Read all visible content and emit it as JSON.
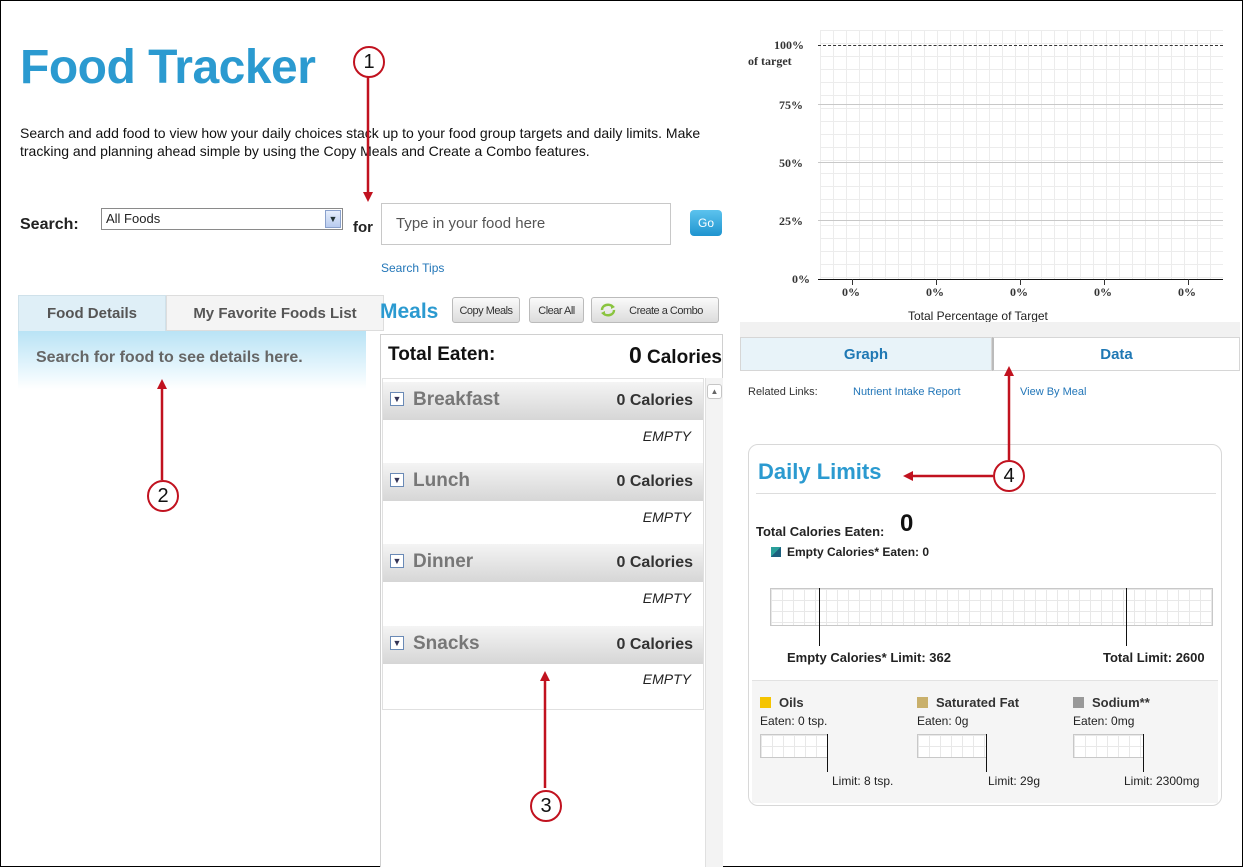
{
  "header": {
    "title": "Food Tracker",
    "intro": "Search and add food to view how your daily choices stack up to your food group targets and daily limits. Make tracking and planning ahead simple by using the Copy Meals and Create a Combo features."
  },
  "search": {
    "label": "Search:",
    "category_selected": "All Foods",
    "for_label": "for",
    "placeholder": "Type in your food here",
    "go_label": "Go",
    "tips_label": "Search Tips"
  },
  "left_tabs": {
    "items": [
      {
        "label": "Food Details",
        "active": true
      },
      {
        "label": "My Favorite Foods List",
        "active": false
      }
    ],
    "details_text": "Search for food to see details here."
  },
  "meals": {
    "title": "Meals",
    "buttons": {
      "copy": "Copy Meals",
      "clear": "Clear All",
      "combo": "Create a Combo"
    },
    "total_label": "Total Eaten:",
    "total_value": "0",
    "total_unit": "Calories",
    "items": [
      {
        "name": "Breakfast",
        "calories": "0 Calories",
        "status": "EMPTY"
      },
      {
        "name": "Lunch",
        "calories": "0 Calories",
        "status": "EMPTY"
      },
      {
        "name": "Dinner",
        "calories": "0 Calories",
        "status": "EMPTY"
      },
      {
        "name": "Snacks",
        "calories": "0 Calories",
        "status": "EMPTY"
      }
    ]
  },
  "graph": {
    "y_ticks": [
      "100%",
      "75%",
      "50%",
      "25%",
      "0%"
    ],
    "y_unit": "of target",
    "x_values": [
      "0%",
      "0%",
      "0%",
      "0%",
      "0%"
    ],
    "x_title": "Total Percentage of Target",
    "tabs": {
      "graph": "Graph",
      "data": "Data"
    }
  },
  "related": {
    "label": "Related Links:",
    "links": [
      "Nutrient Intake Report",
      "View By Meal"
    ]
  },
  "daily_limits": {
    "title": "Daily Limits",
    "total_label": "Total Calories Eaten:",
    "total_value": "0",
    "empty_label": "Empty Calories* Eaten: 0",
    "empty_limit": "Empty Calories* Limit: 362",
    "total_limit": "Total Limit: 2600",
    "nutrients": [
      {
        "name": "Oils",
        "color": "#f5c400",
        "eaten": "Eaten: 0 tsp.",
        "limit": "Limit: 8 tsp."
      },
      {
        "name": "Saturated Fat",
        "color": "#c9b06b",
        "eaten": "Eaten: 0g",
        "limit": "Limit: 29g"
      },
      {
        "name": "Sodium**",
        "color": "#999999",
        "eaten": "Eaten: 0mg",
        "limit": "Limit: 2300mg"
      }
    ]
  },
  "annotations": [
    "1",
    "2",
    "3",
    "4"
  ],
  "colors": {
    "accent": "#2b9ad0",
    "annotation": "#c1121f"
  }
}
